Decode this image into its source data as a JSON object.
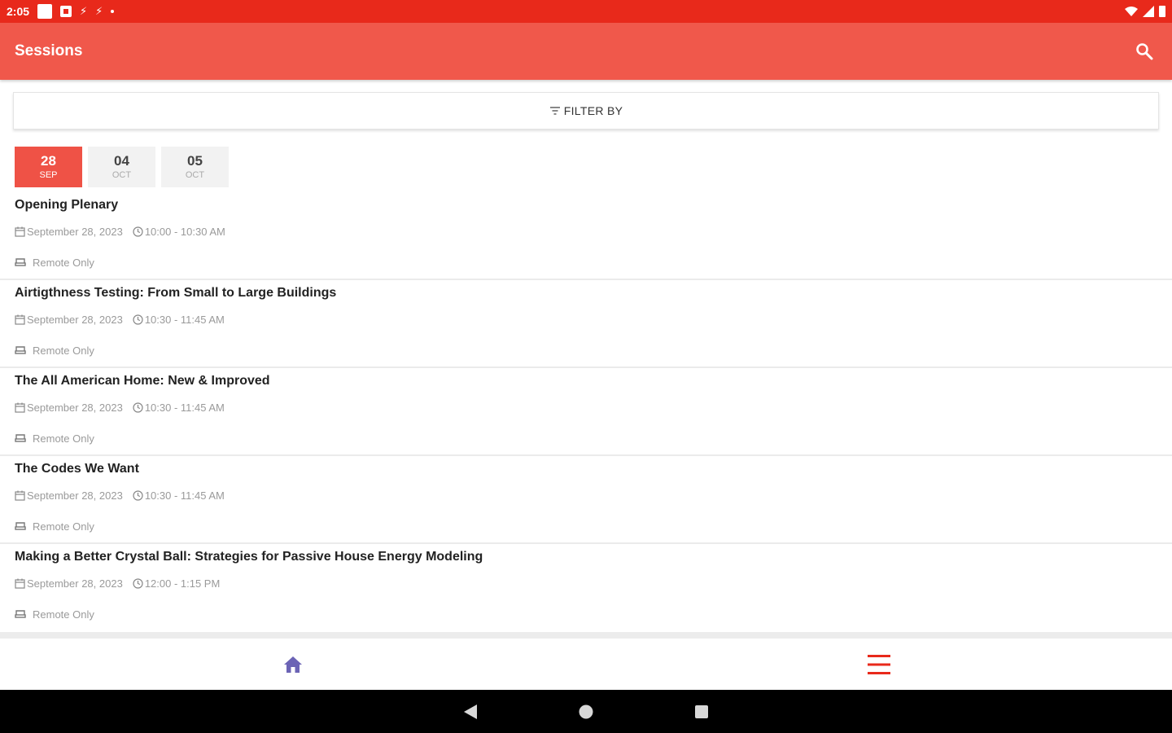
{
  "status_bar": {
    "time": "2:05"
  },
  "app_bar": {
    "title": "Sessions"
  },
  "filter": {
    "label": "FILTER BY"
  },
  "date_tabs": [
    {
      "day": "28",
      "month": "SEP",
      "active": true
    },
    {
      "day": "04",
      "month": "OCT",
      "active": false
    },
    {
      "day": "05",
      "month": "OCT",
      "active": false
    }
  ],
  "sessions": [
    {
      "title": "Opening Plenary",
      "date": "September 28, 2023",
      "time": "10:00 - 10:30 AM",
      "location": "Remote Only"
    },
    {
      "title": "Airtigthness Testing: From Small to Large Buildings",
      "date": "September 28, 2023",
      "time": "10:30 - 11:45 AM",
      "location": "Remote Only"
    },
    {
      "title": "The All American Home: New & Improved",
      "date": "September 28, 2023",
      "time": "10:30 - 11:45 AM",
      "location": "Remote Only"
    },
    {
      "title": "The Codes We Want",
      "date": "September 28, 2023",
      "time": "10:30 - 11:45 AM",
      "location": "Remote Only"
    },
    {
      "title": "Making a Better Crystal Ball: Strategies for Passive House Energy Modeling",
      "date": "September 28, 2023",
      "time": "12:00 - 1:15 PM",
      "location": "Remote Only"
    }
  ],
  "bottom_nav": {
    "home_icon": "home-icon",
    "menu_icon": "menu-icon"
  },
  "colors": {
    "status_bar": "#e8291b",
    "app_bar": "#f0584b",
    "active_tab": "#ef5246",
    "home_icon": "#6b63b5",
    "menu_icon": "#e8291b"
  }
}
